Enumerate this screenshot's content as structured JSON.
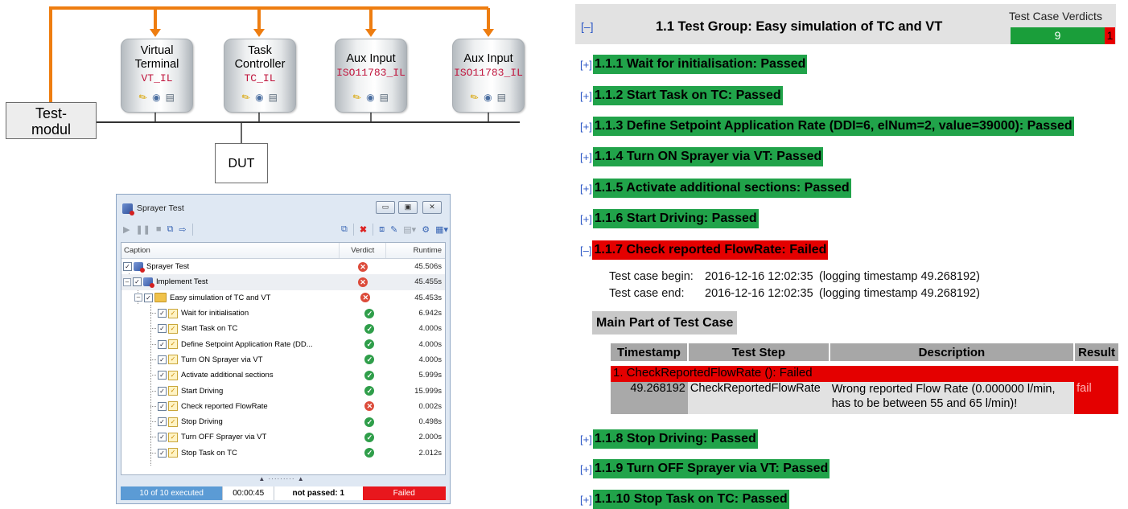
{
  "diagram": {
    "nodes": [
      {
        "line1": "Virtual",
        "line2": "Terminal",
        "line3": "VT_IL"
      },
      {
        "line1": "Task",
        "line2": "Controller",
        "line3": "TC_IL"
      },
      {
        "line1": "Aux Input",
        "line2": "",
        "line3": "ISO11783_IL"
      },
      {
        "line1": "Aux Input",
        "line2": "",
        "line3": "ISO11783_IL"
      }
    ],
    "test_module_label": "Test-\nmodul",
    "test_module_line1": "Test-",
    "test_module_line2": "modul",
    "dut_label": "DUT",
    "colors": {
      "wire": "#ee7d10",
      "bus": "#333333"
    }
  },
  "window": {
    "title": "Sprayer Test",
    "columns": {
      "caption": "Caption",
      "verdict": "Verdict",
      "runtime": "Runtime"
    },
    "rows": [
      {
        "caption": "Sprayer Test",
        "verdict": "fail",
        "runtime": "45.506s"
      },
      {
        "caption": "Implement Test",
        "verdict": "fail",
        "runtime": "45.455s"
      },
      {
        "caption": "Easy simulation of TC and VT",
        "verdict": "fail",
        "runtime": "45.453s"
      },
      {
        "caption": "Wait for initialisation",
        "verdict": "pass",
        "runtime": "6.942s"
      },
      {
        "caption": "Start Task on TC",
        "verdict": "pass",
        "runtime": "4.000s"
      },
      {
        "caption": "Define Setpoint Application Rate (DD...",
        "verdict": "pass",
        "runtime": "4.000s"
      },
      {
        "caption": "Turn ON Sprayer via VT",
        "verdict": "pass",
        "runtime": "4.000s"
      },
      {
        "caption": "Activate additional sections",
        "verdict": "pass",
        "runtime": "5.999s"
      },
      {
        "caption": "Start Driving",
        "verdict": "pass",
        "runtime": "15.999s"
      },
      {
        "caption": "Check reported FlowRate",
        "verdict": "fail",
        "runtime": "0.002s"
      },
      {
        "caption": "Stop Driving",
        "verdict": "pass",
        "runtime": "0.498s"
      },
      {
        "caption": "Turn OFF Sprayer via VT",
        "verdict": "pass",
        "runtime": "2.000s"
      },
      {
        "caption": "Stop Task on TC",
        "verdict": "pass",
        "runtime": "2.012s"
      }
    ],
    "status": {
      "executed": "10 of 10 executed",
      "time": "00:00:45",
      "not_passed": "not passed: 1",
      "result": "Failed"
    }
  },
  "report": {
    "header": {
      "toggle": "[–]",
      "title": "1.1 Test Group: Easy simulation of TC and VT",
      "verdicts_label": "Test Case Verdicts",
      "passed_count": "9",
      "failed_count": "1"
    },
    "test_cases": [
      {
        "toggle": "[+]",
        "label": "1.1.1 Wait for initialisation: Passed",
        "status": "passed"
      },
      {
        "toggle": "[+]",
        "label": "1.1.2 Start Task on TC: Passed",
        "status": "passed"
      },
      {
        "toggle": "[+]",
        "label": "1.1.3 Define Setpoint Application Rate (DDI=6, elNum=2, value=39000): Passed",
        "status": "passed"
      },
      {
        "toggle": "[+]",
        "label": "1.1.4 Turn ON Sprayer via VT: Passed",
        "status": "passed"
      },
      {
        "toggle": "[+]",
        "label": "1.1.5 Activate additional sections: Passed",
        "status": "passed"
      },
      {
        "toggle": "[+]",
        "label": "1.1.6 Start Driving: Passed",
        "status": "passed"
      },
      {
        "toggle": "[–]",
        "label": "1.1.7 Check reported FlowRate: Failed",
        "status": "failed"
      },
      {
        "toggle": "[+]",
        "label": "1.1.8 Stop Driving: Passed",
        "status": "passed"
      },
      {
        "toggle": "[+]",
        "label": "1.1.9 Turn OFF Sprayer via VT: Passed",
        "status": "passed"
      },
      {
        "toggle": "[+]",
        "label": "1.1.10 Stop Task on TC: Passed",
        "status": "passed"
      }
    ],
    "failed_detail": {
      "begin_label": "Test case begin:",
      "begin_value": "2016-12-16 12:02:35",
      "begin_note": "(logging timestamp 49.268192)",
      "end_label": "Test case end:",
      "end_value": "2016-12-16 12:02:35",
      "end_note": "(logging timestamp 49.268192)",
      "section_title": "Main Part of Test Case",
      "table_headers": {
        "timestamp": "Timestamp",
        "step": "Test Step",
        "description": "Description",
        "result": "Result"
      },
      "fail_row": "1. CheckReportedFlowRate (): Failed",
      "step_row": {
        "timestamp": "49.268192",
        "step": "CheckReportedFlowRate",
        "description": "Wrong reported Flow Rate (0.000000 l/min, has to be between 55 and 65 l/min)!",
        "result": "fail"
      }
    },
    "colors": {
      "passed": "#21a34a",
      "failed": "#e40000",
      "link": "#2a56c6"
    }
  }
}
